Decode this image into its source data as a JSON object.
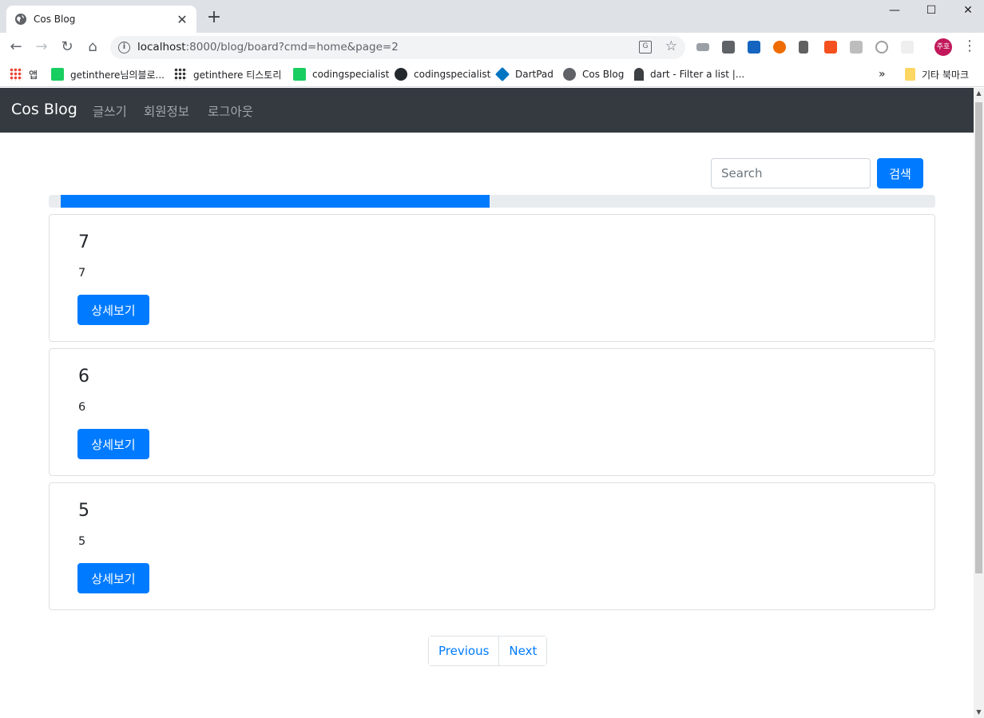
{
  "browser": {
    "tab_title": "Cos Blog",
    "url_host": "localhost",
    "url_rest": ":8000/blog/board?cmd=home&page=2",
    "profile_label": "주호",
    "bookmarks": [
      {
        "label": "앱"
      },
      {
        "label": "getinthere님의블로..."
      },
      {
        "label": "getinthere 티스토리"
      },
      {
        "label": "codingspecialist"
      },
      {
        "label": "codingspecialist"
      },
      {
        "label": "DartPad"
      },
      {
        "label": "Cos Blog"
      },
      {
        "label": "dart - Filter a list |..."
      },
      {
        "label": "기타 북마크"
      }
    ]
  },
  "navbar": {
    "brand": "Cos Blog",
    "links": [
      "글쓰기",
      "회원정보",
      "로그아웃"
    ]
  },
  "search": {
    "placeholder": "Search",
    "button_label": "검색"
  },
  "progress": {
    "fill_fraction": 0.49,
    "color": "#007bff"
  },
  "posts": [
    {
      "title": "7",
      "content": "7",
      "button_label": "상세보기"
    },
    {
      "title": "6",
      "content": "6",
      "button_label": "상세보기"
    },
    {
      "title": "5",
      "content": "5",
      "button_label": "상세보기"
    }
  ],
  "pagination": {
    "previous_label": "Previous",
    "next_label": "Next"
  },
  "colors": {
    "primary": "#007bff",
    "navbar_bg": "#343a40"
  }
}
